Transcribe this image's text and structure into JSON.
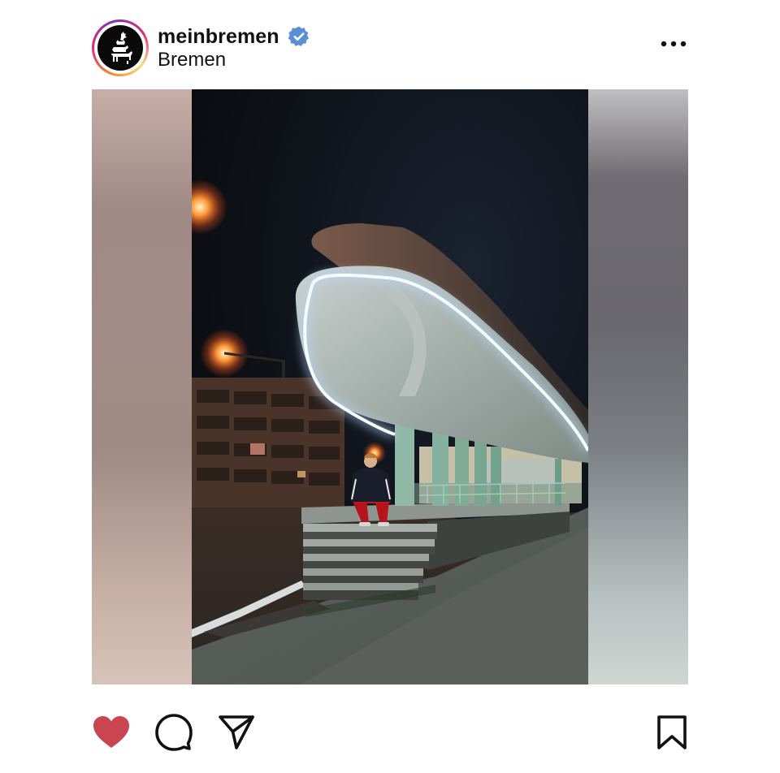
{
  "post": {
    "username": "meinbremen",
    "location": "Bremen",
    "verified": true
  },
  "icons": {
    "avatar": "bremen-town-musicians-logo",
    "verified": "verified-badge-icon",
    "more": "more-options-icon",
    "like": "heart-icon",
    "comment": "comment-icon",
    "share": "send-icon",
    "save": "bookmark-icon"
  },
  "state": {
    "liked": true,
    "saved": false
  },
  "colors": {
    "like_active": "#c94552",
    "verified_blue": "#5b8ed6",
    "text": "#111111",
    "neon": "#eaf4ff"
  }
}
